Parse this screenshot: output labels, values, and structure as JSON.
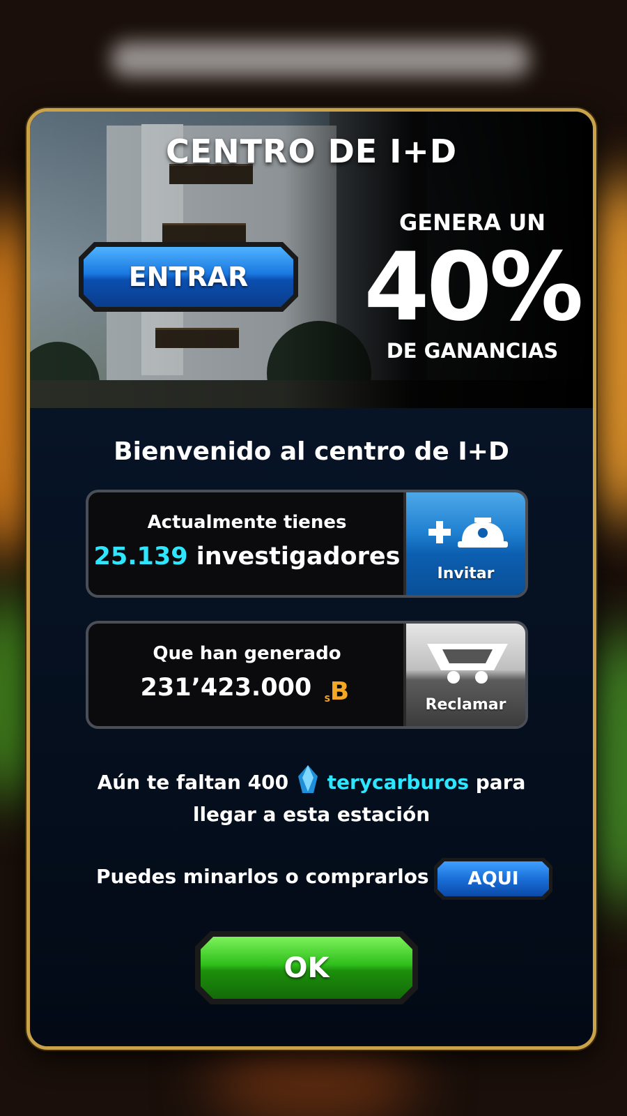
{
  "banner": {
    "title": "CENTRO DE I+D",
    "enter_label": "ENTRAR",
    "promo_top": "GENERA UN",
    "promo_value": "40%",
    "promo_bottom": "DE GANANCIAS"
  },
  "welcome": "Bienvenido al centro de I+D",
  "researchers": {
    "line1": "Actualmente tienes",
    "count": "25.139",
    "unit": "investigadores",
    "invite_label": "Invitar",
    "invite_icon": "add-researcher-icon"
  },
  "earnings": {
    "line1": "Que han generado",
    "amount": "231’423.000",
    "currency_icon": "sb-coin-icon",
    "claim_label": "Reclamar",
    "claim_icon": "mine-cart-icon"
  },
  "requirement": {
    "prefix": "Aún te faltan 400",
    "resource": "terycarburos",
    "suffix": "para",
    "line2": "llegar a esta estación"
  },
  "buy": {
    "text": "Puedes minarlos o comprarlos",
    "button_label": "AQUI"
  },
  "ok_label": "OK",
  "colors": {
    "frame": "#c9a24a",
    "highlight": "#2ee6ff",
    "coin": "#f5a623",
    "ok_green": "#2fbf1c",
    "enter_blue": "#1a78e0"
  }
}
